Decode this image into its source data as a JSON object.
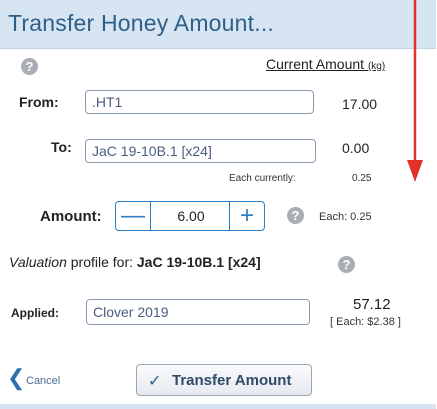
{
  "dialog": {
    "title": "Transfer Honey Amount..."
  },
  "header": {
    "current_amount_label": "Current Amount",
    "unit": "(kg)"
  },
  "from": {
    "label": "From:",
    "value": ".HT1",
    "current_amount": "17.00"
  },
  "to": {
    "label": "To:",
    "value": "JaC 19-10B.1 [x24]",
    "current_amount": "0.00",
    "each_currently_label": "Each currently:",
    "each_currently_value": "0.25"
  },
  "amount": {
    "label": "Amount:",
    "minus": "—",
    "value": "6.00",
    "plus": "+",
    "each_text": "Each: 0.25"
  },
  "valuation": {
    "prefix": "Valuation",
    "middle": " profile for: ",
    "target": "JaC 19-10B.1 [x24]"
  },
  "applied": {
    "label": "Applied:",
    "value": "Clover 2019",
    "total": "57.12",
    "each_text": "[ Each: $2.38 ]"
  },
  "actions": {
    "cancel_label": "Cancel",
    "transfer_label": "Transfer Amount"
  },
  "icons": {
    "help": "help-circle-icon",
    "cancel": "chevron-left-icon",
    "transfer": "checkmark-icon"
  },
  "colors": {
    "title_bar": "#d7e5f2",
    "title_text": "#2e5f88",
    "accent": "#2d7fc1",
    "arrow": "#e0312b"
  }
}
